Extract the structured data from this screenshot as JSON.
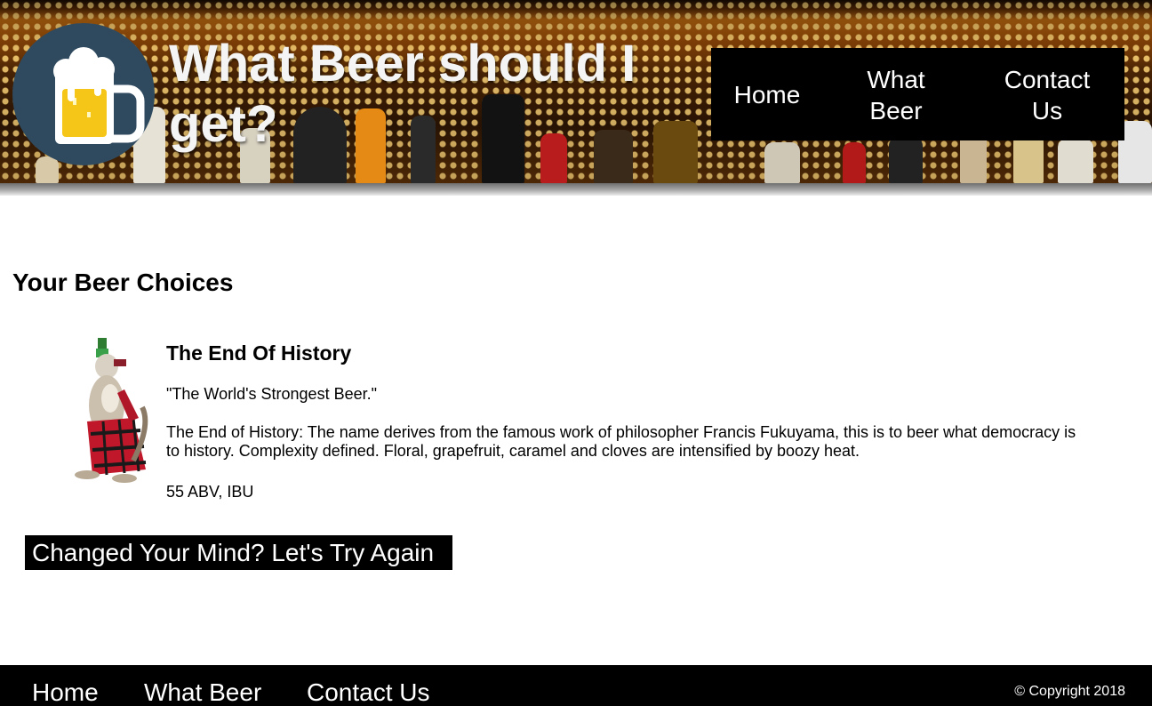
{
  "header": {
    "title": "What Beer should I get?",
    "logo_icon": "beer-mug-icon",
    "nav": [
      {
        "label": "Home"
      },
      {
        "label": "What Beer"
      },
      {
        "label": "Contact Us"
      }
    ]
  },
  "main": {
    "heading": "Your Beer Choices",
    "beer": {
      "name": "The End Of History",
      "tagline": "\"The World's Strongest Beer.\"",
      "description": "The End of History: The name derives from the famous work of philosopher Francis Fukuyama, this is to beer what democracy is to history. Complexity defined. Floral, grapefruit, caramel and cloves are intensified by boozy heat.",
      "stats": "55 ABV, IBU"
    },
    "retry_button": "Changed Your Mind? Let's Try Again"
  },
  "footer": {
    "nav": [
      {
        "label": "Home"
      },
      {
        "label": "What Beer"
      },
      {
        "label": "Contact Us"
      }
    ],
    "copyright": "© Copyright 2018"
  },
  "colors": {
    "nav_background": "#000000",
    "logo_circle": "#2f4a5f",
    "beer_yellow": "#f5c518",
    "title_text": "#f4f4f4"
  }
}
